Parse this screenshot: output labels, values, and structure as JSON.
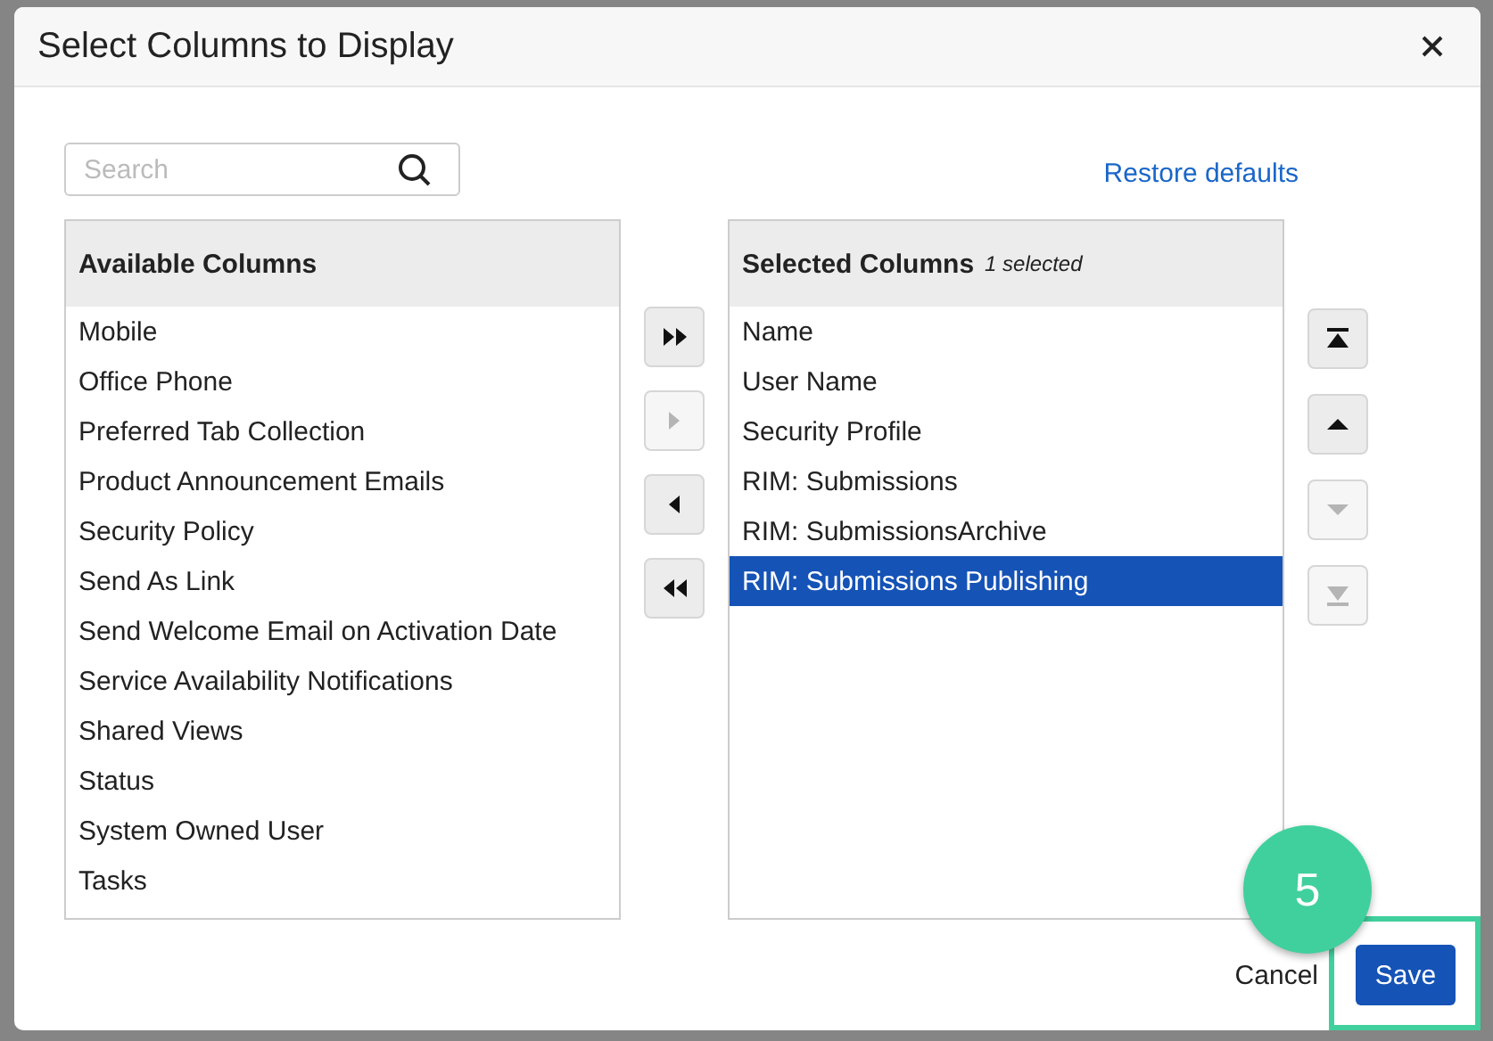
{
  "dialog": {
    "title": "Select Columns to Display"
  },
  "search": {
    "placeholder": "Search"
  },
  "restore_link": "Restore defaults",
  "available": {
    "title": "Available Columns",
    "items": [
      {
        "label": "Mobile",
        "selected": false
      },
      {
        "label": "Office Phone",
        "selected": false
      },
      {
        "label": "Preferred Tab Collection",
        "selected": false
      },
      {
        "label": "Product Announcement Emails",
        "selected": false
      },
      {
        "label": "Security Policy",
        "selected": false
      },
      {
        "label": "Send As Link",
        "selected": false
      },
      {
        "label": "Send Welcome Email on Activation Date",
        "selected": false
      },
      {
        "label": "Service Availability Notifications",
        "selected": false
      },
      {
        "label": "Shared Views",
        "selected": false
      },
      {
        "label": "Status",
        "selected": false
      },
      {
        "label": "System Owned User",
        "selected": false
      },
      {
        "label": "Tasks",
        "selected": false
      }
    ]
  },
  "transfer_buttons": [
    {
      "kind": "add-all",
      "disabled": false
    },
    {
      "kind": "add",
      "disabled": true
    },
    {
      "kind": "remove",
      "disabled": false
    },
    {
      "kind": "remove-all",
      "disabled": false
    }
  ],
  "selected": {
    "title": "Selected Columns",
    "count": "1 selected",
    "items": [
      {
        "label": "Name",
        "selected": false
      },
      {
        "label": "User Name",
        "selected": false
      },
      {
        "label": "Security Profile",
        "selected": false
      },
      {
        "label": "RIM: Submissions",
        "selected": false
      },
      {
        "label": "RIM: SubmissionsArchive",
        "selected": false
      },
      {
        "label": "RIM: Submissions Publishing",
        "selected": true
      }
    ]
  },
  "order_buttons": [
    {
      "kind": "top",
      "disabled": false
    },
    {
      "kind": "up",
      "disabled": false
    },
    {
      "kind": "down",
      "disabled": true
    },
    {
      "kind": "bottom",
      "disabled": true
    }
  ],
  "step_badge": "5",
  "footer": {
    "cancel": "Cancel",
    "save": "Save"
  }
}
